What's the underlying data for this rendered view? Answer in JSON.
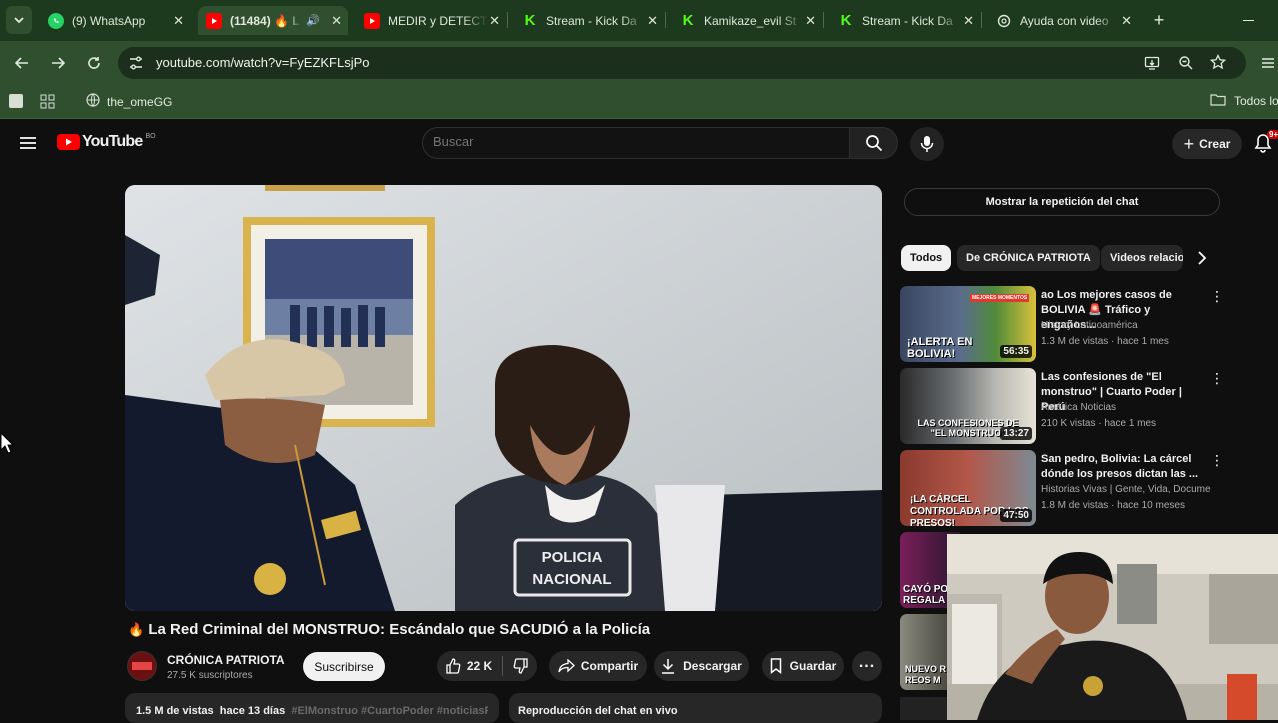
{
  "browser": {
    "tabs": [
      {
        "label": "(9) WhatsApp",
        "icon": "whatsapp-icon"
      },
      {
        "label": "(11484) 🔥 L",
        "icon": "youtube-icon",
        "active": true
      },
      {
        "label": "MEDIR y DETECT",
        "icon": "youtube-icon"
      },
      {
        "label": "Stream - Kick Da",
        "icon": "kick-icon"
      },
      {
        "label": "Kamikaze_evil St",
        "icon": "kick-icon"
      },
      {
        "label": "Stream - Kick Da",
        "icon": "kick-icon"
      },
      {
        "label": "Ayuda con video",
        "icon": "chatgpt-icon"
      }
    ],
    "url": "youtube.com/watch?v=FyEZKFLsjPo",
    "bookmarks": {
      "item": "the_omeGG",
      "folder": "Todos los"
    }
  },
  "youtube": {
    "logo_text": "YouTube",
    "country": "BO",
    "search_placeholder": "Buscar",
    "create_label": "Crear",
    "notification_count": "9+"
  },
  "video": {
    "title_emoji": "🔥",
    "title": "La Red Criminal del MONSTRUO: Escándalo que SACUDIÓ a la Policía",
    "channel": "CRÓNICA PATRIOTA",
    "subscribers": "27.5 K suscriptores",
    "subscribe_label": "Suscribirse",
    "likes": "22 K",
    "share_label": "Compartir",
    "download_label": "Descargar",
    "save_label": "Guardar",
    "views": "1.5 M de vistas",
    "date": "hace 13 días",
    "hashtags": "#ElMonstruo #CuartoPoder #noticiasPe",
    "live_chat_label": "Reproducción del chat en vivo",
    "vest_text_1": "POLICIA",
    "vest_text_2": "NACIONAL"
  },
  "sidebar": {
    "chat_replay_button": "Mostrar la repetición del chat",
    "chips": [
      "Todos",
      "De CRÓNICA PATRIOTA",
      "Videos relacio"
    ],
    "recommendations": [
      {
        "title": "ao Los mejores casos de BOLIVIA 🚨 Tráfico y engaños...",
        "channel": "History Latinoamérica",
        "meta": "1.3 M de vistas · hace 1 mes",
        "duration": "56:35",
        "thumb_text": "¡ALERTA EN BOLIVIA!",
        "badge": "MEJORES MOMENTOS"
      },
      {
        "title": "Las confesiones de \"El monstruo\" | Cuarto Poder | Perú",
        "channel": "América Noticias",
        "meta": "210 K vistas · hace 1 mes",
        "duration": "13:27",
        "thumb_text": "LAS CONFESIONES DE \"EL MONSTRUO\""
      },
      {
        "title": "San pedro, Bolivia: La cárcel dónde los presos dictan las ...",
        "channel": "Historias Vivas | Gente, Vida, Documenta...",
        "meta": "1.8 M de vistas · hace 10 meses",
        "duration": "47:50",
        "thumb_text": "¡LA CÁRCEL CONTROLADA POR LOS PRESOS!"
      },
      {
        "thumb_text": "CAYÓ PO REGALA"
      },
      {
        "thumb_text": "NUEVO R REOS M"
      }
    ]
  },
  "colors": {
    "youtube_red": "#ff0000",
    "browser_green": "#2f4f2f",
    "page_bg": "#0f0f0f"
  }
}
